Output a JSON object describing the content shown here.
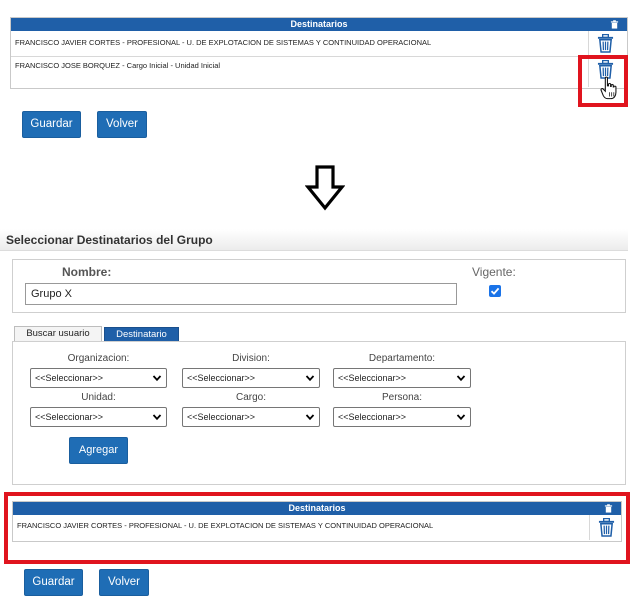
{
  "top_table": {
    "header": "Destinatarios",
    "rows": [
      "FRANCISCO JAVIER CORTES - PROFESIONAL - U. DE EXPLOTACION DE SISTEMAS Y CONTINUIDAD OPERACIONAL",
      "FRANCISCO JOSE BORQUEZ - Cargo Inicial - Unidad Inicial"
    ]
  },
  "top_buttons": {
    "guardar": "Guardar",
    "volver": "Volver"
  },
  "section_title": "Seleccionar Destinatarios del Grupo",
  "form": {
    "nombre_label": "Nombre:",
    "nombre_value": "Grupo X",
    "vigente_label": "Vigente:",
    "vigente_checked": true
  },
  "tabs": {
    "buscar": "Buscar usuario",
    "destinatario": "Destinatario"
  },
  "filters": {
    "organizacion_label": "Organizacion:",
    "division_label": "Division:",
    "departamento_label": "Departamento:",
    "unidad_label": "Unidad:",
    "cargo_label": "Cargo:",
    "persona_label": "Persona:",
    "placeholder": "<<Seleccionar>>"
  },
  "agregar_label": "Agregar",
  "bottom_table": {
    "header": "Destinatarios",
    "rows": [
      "FRANCISCO JAVIER CORTES - PROFESIONAL - U. DE EXPLOTACION DE SISTEMAS Y CONTINUIDAD OPERACIONAL"
    ]
  },
  "bottom_buttons": {
    "guardar": "Guardar",
    "volver": "Volver"
  },
  "colors": {
    "header_blue": "#1f5fa8",
    "button_blue": "#1f6db5",
    "highlight_red": "#e0141e",
    "checkbox_blue": "#1a73e8"
  }
}
